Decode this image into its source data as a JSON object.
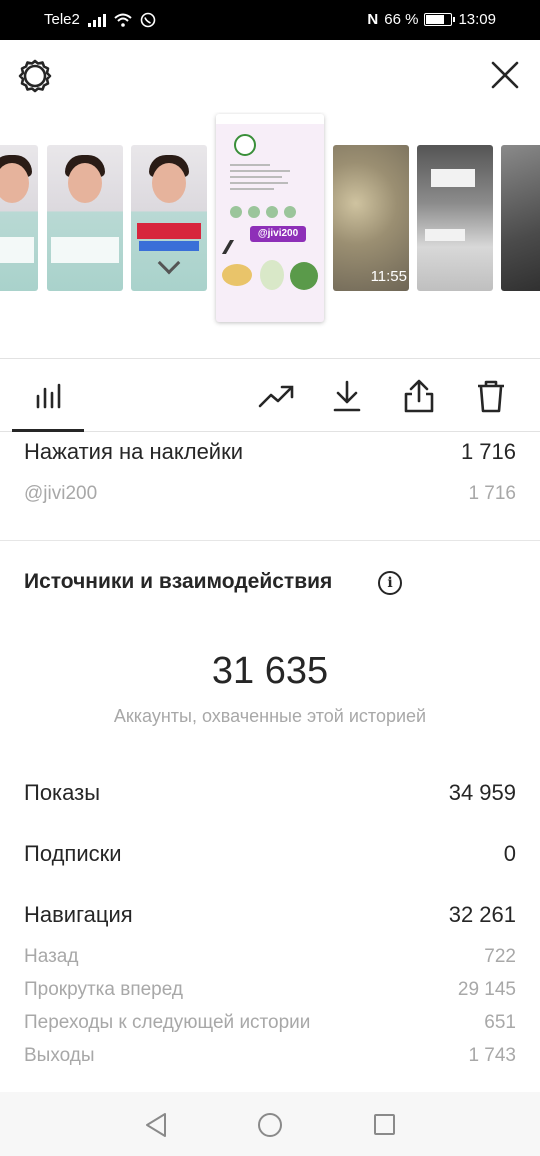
{
  "status_bar": {
    "carrier": "Tele2",
    "battery_percent": "66 %",
    "time": "13:09",
    "nfc_label": "N"
  },
  "icons": {
    "settings": "gear-icon",
    "close": "close-icon",
    "insights": "bar-chart-icon",
    "promote": "trending-up-icon",
    "download": "download-icon",
    "share": "share-icon",
    "delete": "trash-icon",
    "info": "info-icon"
  },
  "carousel": {
    "selected_handle": "@jivi200",
    "video_duration": "11:55"
  },
  "sticker_taps": {
    "label": "Нажатия на наклейки",
    "value": "1 716",
    "sub_label": "@jivi200",
    "sub_value": "1 716"
  },
  "section": {
    "title": "Источники и взаимодействия",
    "info_glyph": "i"
  },
  "reach": {
    "value": "31 635",
    "caption": "Аккаунты, охваченные этой историей"
  },
  "metrics": [
    {
      "label": "Показы",
      "value": "34 959"
    },
    {
      "label": "Подписки",
      "value": "0"
    },
    {
      "label": "Навигация",
      "value": "32 261"
    }
  ],
  "navigation_details": [
    {
      "label": "Назад",
      "value": "722"
    },
    {
      "label": "Прокрутка вперед",
      "value": "29 145"
    },
    {
      "label": "Переходы к следующей истории",
      "value": "651"
    },
    {
      "label": "Выходы",
      "value": "1 743"
    }
  ],
  "colors": {
    "text": "#262626",
    "muted": "#a8a8a8",
    "accent_tag": "#8e2fb8"
  }
}
